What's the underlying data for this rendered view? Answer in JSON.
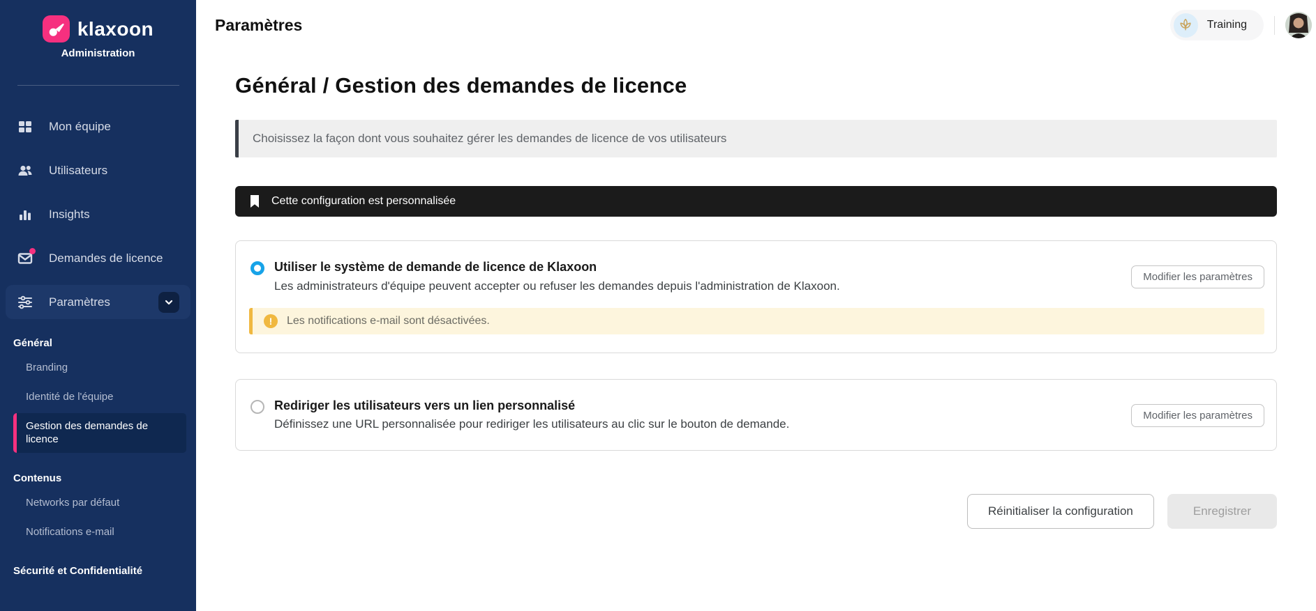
{
  "colors": {
    "sidebar_bg": "#16305f",
    "brand_pink": "#f6307f",
    "active_bar_pink": "#f5317f",
    "radio_blue": "#17a3e8",
    "banner_black": "#1b1b1b",
    "warning_amber": "#f0b840",
    "warning_bg": "#fdf5dd",
    "note_bg": "#efefef"
  },
  "icons": {
    "logo": "klaxon-horn-icon",
    "nav": [
      "grid-icon",
      "users-icon",
      "bar-chart-icon",
      "mail-icon",
      "sliders-icon"
    ],
    "nav_badge": "pink-notification-dot",
    "expand": "chevron-down-icon",
    "banner": "bookmark-icon",
    "warning": "exclamation-circle-icon",
    "training": "lotus-flower-icon"
  },
  "sidebar": {
    "brand": "klaxoon",
    "subtitle": "Administration",
    "nav": [
      {
        "label": "Mon équipe"
      },
      {
        "label": "Utilisateurs"
      },
      {
        "label": "Insights"
      },
      {
        "label": "Demandes de licence",
        "badge": true
      },
      {
        "label": "Paramètres",
        "expanded": true
      }
    ],
    "sections": [
      {
        "header": "Général",
        "items": [
          {
            "label": "Branding"
          },
          {
            "label": "Identité de l'équipe"
          },
          {
            "label": "Gestion des demandes de licence",
            "active": true
          }
        ]
      },
      {
        "header": "Contenus",
        "items": [
          {
            "label": "Networks par défaut"
          },
          {
            "label": "Notifications e-mail"
          }
        ]
      },
      {
        "header": "Sécurité et Confidentialité",
        "items": []
      }
    ]
  },
  "topbar": {
    "title": "Paramètres",
    "training_label": "Training"
  },
  "main": {
    "heading": "Général / Gestion des demandes de licence",
    "note": "Choisissez la façon dont vous souhaitez gérer les demandes de licence de vos utilisateurs",
    "banner": "Cette configuration est personnalisée",
    "options": [
      {
        "title": "Utiliser le système de demande de licence de Klaxoon",
        "description": "Les administrateurs d'équipe peuvent accepter ou refuser les demandes depuis l'administration de Klaxoon.",
        "button": "Modifier les paramètres",
        "selected": true,
        "warning": "Les notifications e-mail sont désactivées."
      },
      {
        "title": "Rediriger les utilisateurs vers un lien personnalisé",
        "description": "Définissez une URL personnalisée pour rediriger les utilisateurs au clic sur le bouton de demande.",
        "button": "Modifier les paramètres",
        "selected": false
      }
    ],
    "footer": {
      "reset": "Réinitialiser la configuration",
      "save": "Enregistrer"
    }
  }
}
